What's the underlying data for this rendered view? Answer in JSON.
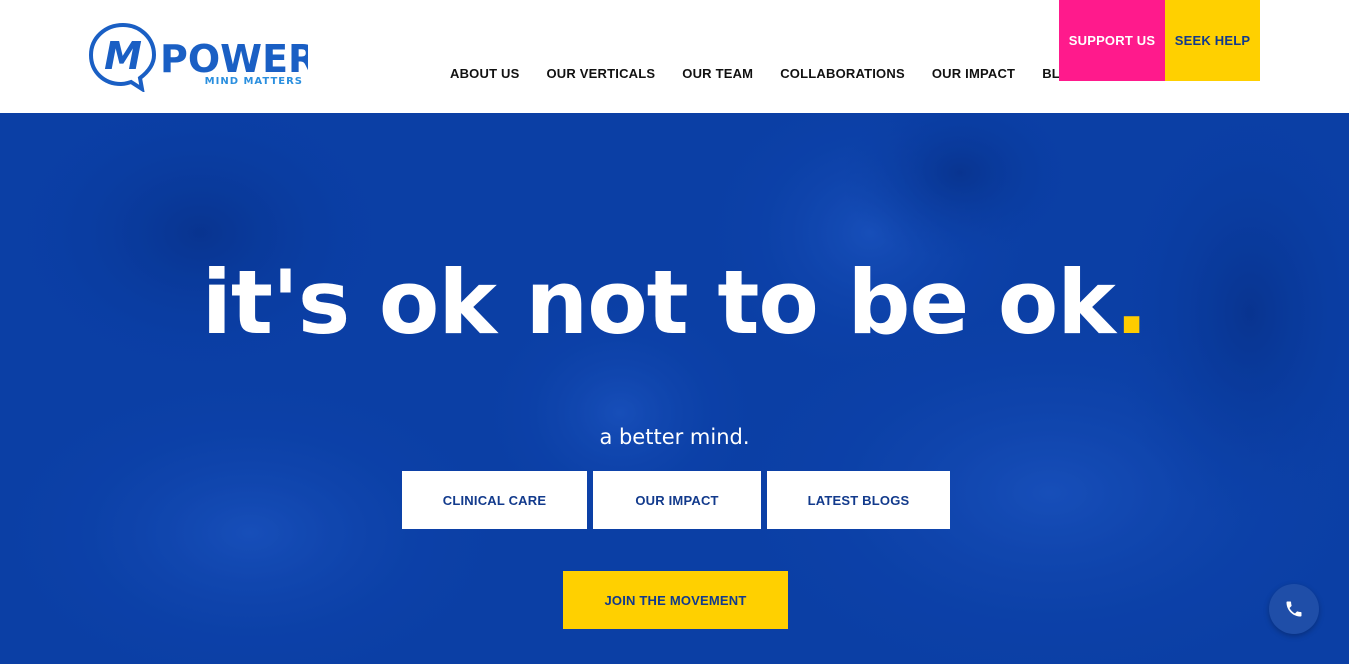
{
  "logo": {
    "brand": "POWER",
    "tagline": "MIND MATTERS",
    "mark_letter": "M"
  },
  "nav": {
    "items": [
      {
        "label": "ABOUT US"
      },
      {
        "label": "OUR VERTICALS"
      },
      {
        "label": "OUR TEAM"
      },
      {
        "label": "COLLABORATIONS"
      },
      {
        "label": "OUR IMPACT"
      },
      {
        "label": "BLOG"
      }
    ],
    "support_label": "SUPPORT US",
    "help_label": "SEEK HELP"
  },
  "hero": {
    "title": "it's ok not to be ok",
    "title_dot": ".",
    "subtitle": "a better mind.",
    "buttons": [
      {
        "label": "CLINICAL CARE"
      },
      {
        "label": "OUR IMPACT"
      },
      {
        "label": "LATEST BLOGS"
      }
    ],
    "join_label": "JOIN THE MOVEMENT"
  },
  "icons": {
    "phone": "phone-icon"
  },
  "colors": {
    "hero_blue": "#0a3fa6",
    "support_pink": "#ff1a8c",
    "help_yellow": "#ffd000",
    "dark_blue_text": "#123a8c",
    "logo_blue": "#1a5fc4"
  }
}
